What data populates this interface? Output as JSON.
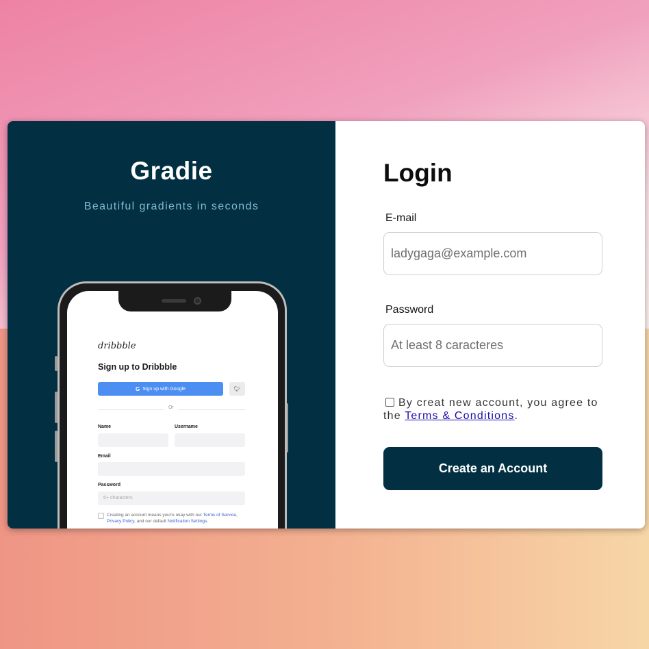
{
  "colors": {
    "panel": "#022f41",
    "accent_text": "#7fbcd6",
    "button": "#022f41",
    "link": "#1a0dab",
    "mock_primary": "#4c8ef1",
    "mock_submit": "#e8508e"
  },
  "brand": {
    "title": "Gradie",
    "tagline": "Beautiful gradients in seconds"
  },
  "mockup": {
    "logo": "dribbble",
    "title": "Sign up to Dribbble",
    "google_button": "Sign up with Google",
    "google_icon": "G",
    "twitter_icon": "twitter-icon",
    "or_text": "Or",
    "name_label": "Name",
    "username_label": "Username",
    "email_label": "Email",
    "password_label": "Password",
    "password_placeholder": "6+ characters",
    "terms_prefix": "Creating an account means you're okay with our ",
    "terms_link": "Terms of Service",
    "terms_sep": ", ",
    "privacy_link": "Privacy Policy",
    "terms_mid": ", and our default ",
    "notif_link": "Notification Settings",
    "terms_end": "."
  },
  "form": {
    "title": "Login",
    "email_label": "E-mail",
    "email_placeholder": "ladygaga@example.com",
    "password_label": "Password",
    "password_placeholder": "At least 8 caracteres",
    "agree_text": "By creat new account, you agree to the ",
    "terms_link": "Terms & Conditions",
    "agree_end": ".",
    "submit_label": "Create an Account"
  }
}
